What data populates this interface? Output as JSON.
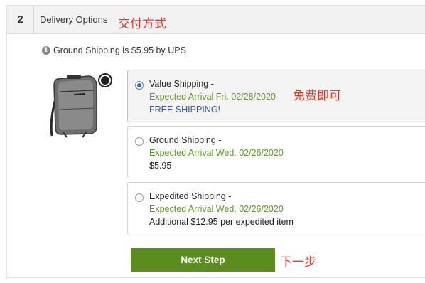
{
  "step": {
    "number": "2",
    "title": "Delivery Options",
    "annotation": "交付方式"
  },
  "info": {
    "icon": "info-icon",
    "text": "Ground Shipping is $5.95 by UPS"
  },
  "product": {
    "image": "backpack-image"
  },
  "options": [
    {
      "title": "Value Shipping -",
      "arrival": "Expected Arrival Fri. 02/28/2020",
      "cost": "FREE SHIPPING!",
      "selected": true,
      "annotation": "免费即可"
    },
    {
      "title": "Ground Shipping -",
      "arrival": "Expected Arrival Wed. 02/26/2020",
      "cost": "$5.95",
      "selected": false
    },
    {
      "title": "Expedited Shipping -",
      "arrival": "Expected Arrival Wed. 02/26/2020",
      "cost": "Additional $12.95 per expedited item",
      "selected": false
    }
  ],
  "next_button": {
    "label": "Next Step",
    "annotation": "下一步"
  },
  "colors": {
    "arrival_green": "#5a9a22",
    "free_blue": "#2b5aa8",
    "button_green": "#5a8c1e",
    "annotation_red": "#e23b2e"
  }
}
